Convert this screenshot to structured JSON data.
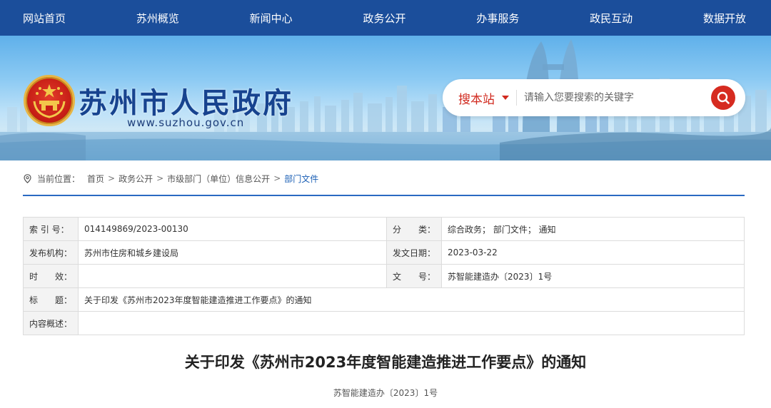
{
  "nav": {
    "items": [
      {
        "label": "网站首页"
      },
      {
        "label": "苏州概览"
      },
      {
        "label": "新闻中心"
      },
      {
        "label": "政务公开"
      },
      {
        "label": "办事服务"
      },
      {
        "label": "政民互动"
      },
      {
        "label": "数据开放"
      }
    ]
  },
  "header": {
    "title": "苏州市人民政府",
    "url": "www.suzhou.gov.cn"
  },
  "search": {
    "scope": "搜本站",
    "placeholder": "请输入您要搜索的关键字"
  },
  "breadcrumb": {
    "prefix": "当前位置：",
    "items": [
      "首页",
      "政务公开",
      "市级部门（单位）信息公开",
      "部门文件"
    ]
  },
  "info": {
    "rows": [
      {
        "k1": "索 引 号：",
        "v1": "014149869/2023-00130",
        "k2": "分　　类：",
        "v2": "综合政务；  部门文件；  通知"
      },
      {
        "k1": "发布机构：",
        "v1": "苏州市住房和城乡建设局",
        "k2": "发文日期：",
        "v2": "2023-03-22"
      },
      {
        "k1": "时　　效：",
        "v1": "",
        "k2": "文　　号：",
        "v2": "苏智能建造办〔2023〕1号"
      },
      {
        "k1": "标　　题：",
        "v1": "关于印发《苏州市2023年度智能建造推进工作要点》的通知"
      },
      {
        "k1": "内容概述：",
        "v1": ""
      }
    ]
  },
  "article": {
    "title": "关于印发《苏州市2023年度智能建造推进工作要点》的通知",
    "doc_number": "苏智能建造办〔2023〕1号"
  },
  "colors": {
    "nav_bg": "#1b4e9b",
    "accent_red": "#d62b20",
    "link_blue": "#1b5fb5"
  },
  "icons": {
    "search": "search-icon",
    "location": "location-pin-icon",
    "emblem": "national-emblem-icon",
    "dropdown": "chevron-down-icon"
  }
}
